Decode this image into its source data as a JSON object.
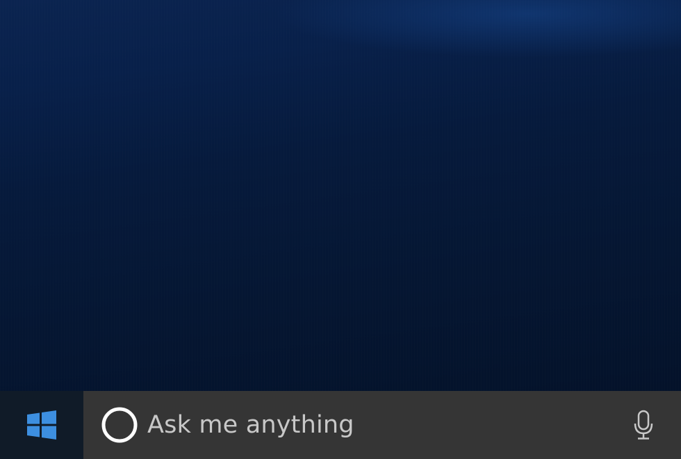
{
  "taskbar": {
    "start_icon": "windows-logo-icon",
    "search": {
      "cortana_icon": "cortana-ring-icon",
      "placeholder": "Ask me anything",
      "mic_icon": "microphone-icon"
    }
  },
  "colors": {
    "wallpaper": "#06152e",
    "taskbar": "#111c2a",
    "search_box": "#353535",
    "windows_logo": "#3d8fe0",
    "placeholder_text": "#c8c8c8",
    "cortana_ring": "#ffffff"
  }
}
